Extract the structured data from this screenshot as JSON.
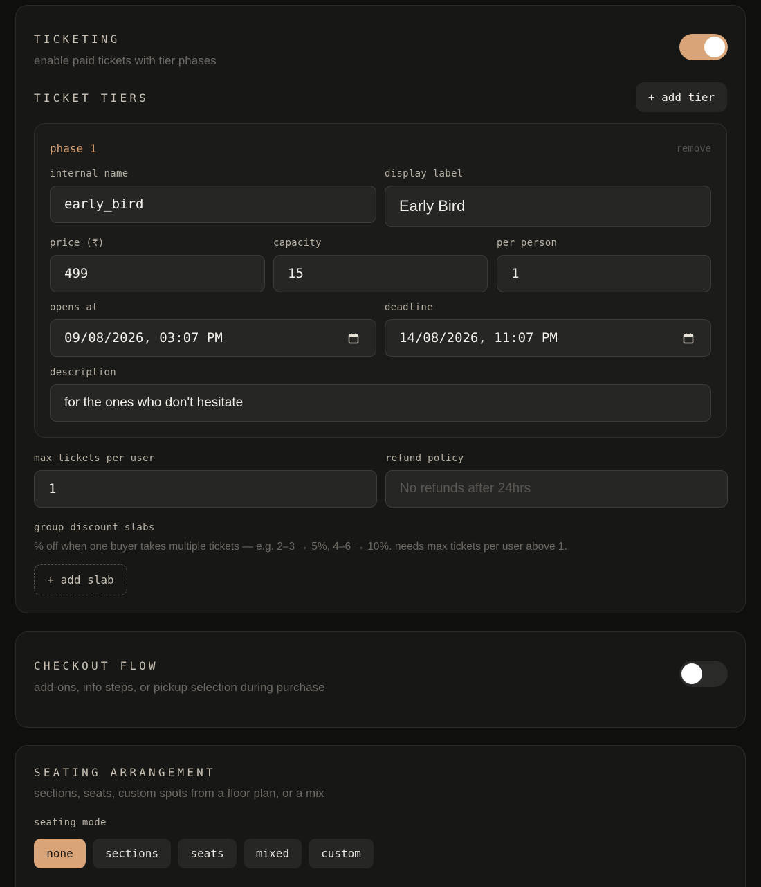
{
  "ticketing": {
    "title": "TICKETING",
    "subtitle": "enable paid tickets with tier phases",
    "enabled": true,
    "tiers_title": "TICKET TIERS",
    "add_tier_label": "+ add tier",
    "tier": {
      "phase_label": "phase 1",
      "remove_label": "remove",
      "internal_name_label": "internal name",
      "internal_name_value": "early_bird",
      "display_label_label": "display label",
      "display_label_value": "Early Bird",
      "price_label": "price (₹)",
      "price_value": "499",
      "capacity_label": "capacity",
      "capacity_value": "15",
      "per_person_label": "per person",
      "per_person_value": "1",
      "opens_at_label": "opens at",
      "opens_at_value": "09/08/2026, 03:07 PM",
      "deadline_label": "deadline",
      "deadline_value": "14/08/2026, 11:07 PM",
      "description_label": "description",
      "description_value": "for the ones who don't hesitate"
    },
    "max_tickets_label": "max tickets per user",
    "max_tickets_value": "1",
    "refund_policy_label": "refund policy",
    "refund_policy_placeholder": "No refunds after 24hrs",
    "group_discount_label": "group discount slabs",
    "group_discount_hint": "% off when one buyer takes multiple tickets — e.g. 2–3 → 5%, 4–6 → 10%. needs max tickets per user above 1.",
    "add_slab_label": "+ add slab"
  },
  "checkout": {
    "title": "CHECKOUT FLOW",
    "subtitle": "add-ons, info steps, or pickup selection during purchase",
    "enabled": false
  },
  "seating": {
    "title": "SEATING ARRANGEMENT",
    "subtitle": "sections, seats, custom spots from a floor plan, or a mix",
    "mode_label": "seating mode",
    "modes": [
      "none",
      "sections",
      "seats",
      "mixed",
      "custom"
    ],
    "selected_mode": "none"
  },
  "colors": {
    "accent": "#d8a478",
    "background": "#0f0f0e",
    "card": "#171716",
    "input": "#262625"
  },
  "icons": {
    "calendar": "calendar-icon"
  }
}
